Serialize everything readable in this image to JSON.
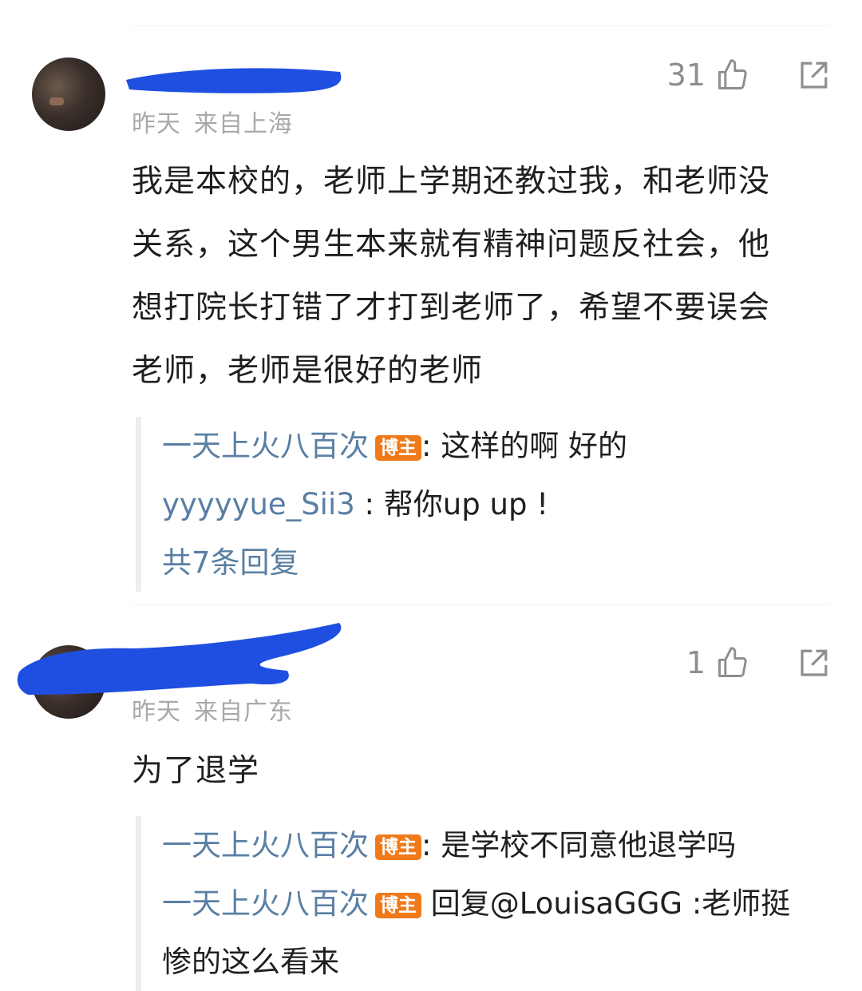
{
  "comments": [
    {
      "time": "昨天",
      "location": "来自上海",
      "likes": "31",
      "lines": [
        "我是本校的，老师上学期还教过我，和老师没",
        "关系，这个男生本来就有精神问题反社会，他",
        "想打院长打错了才打到老师了，希望不要误会",
        "老师，老师是很好的老师"
      ],
      "replies": [
        {
          "name": "一天上火八百次",
          "badge": "博主",
          "sep": ": ",
          "text": "这样的啊 好的"
        },
        {
          "name": "yyyyyue_Sii3",
          "sep": " : ",
          "text": "帮你up up !"
        }
      ],
      "more": "共7条回复"
    },
    {
      "time": "昨天",
      "location": "来自广东",
      "likes": "1",
      "lines": [
        "为了退学"
      ],
      "replies": [
        {
          "name": "一天上火八百次",
          "badge": "博主",
          "sep": ": ",
          "text": "是学校不同意他退学吗"
        },
        {
          "name": "一天上火八百次",
          "badge": "博主",
          "sep": " ",
          "text": "回复@LouisaGGG :老师挺"
        },
        {
          "text": "惨的这么看来"
        }
      ]
    }
  ],
  "icons": {
    "like": "thumbs-up-icon",
    "share": "share-icon"
  },
  "colors": {
    "name_link": "#5a7fa4",
    "badge_bg": "#f07a1a",
    "redaction": "#1f4fe0"
  }
}
